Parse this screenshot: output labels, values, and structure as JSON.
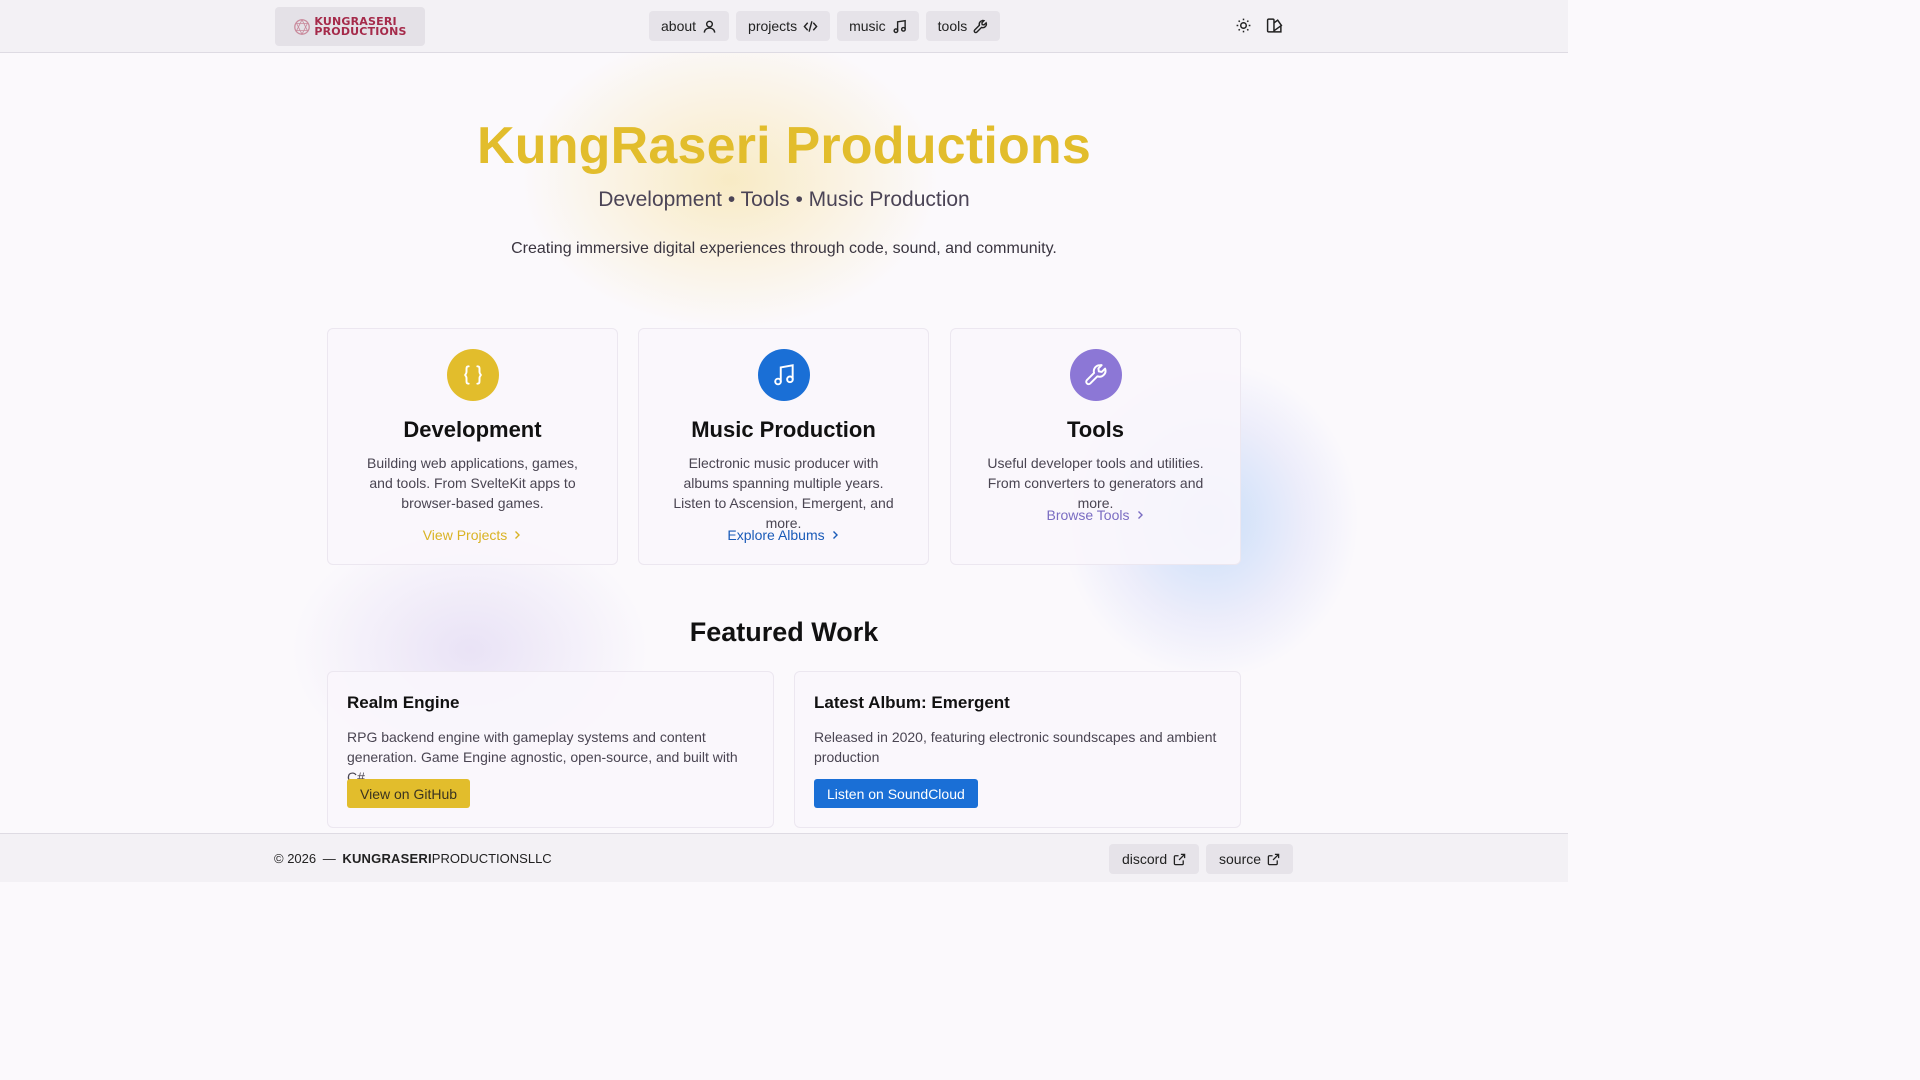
{
  "header": {
    "logo_line1": "KUNGRASERI",
    "logo_line2": "PRODUCTIONS",
    "nav": [
      {
        "label": "about",
        "icon": "user-icon"
      },
      {
        "label": "projects",
        "icon": "code-icon"
      },
      {
        "label": "music",
        "icon": "music-note-icon"
      },
      {
        "label": "tools",
        "icon": "wrench-icon"
      }
    ],
    "theme_toggle_icon": "sun-icon",
    "palette_icon": "palette-icon"
  },
  "hero": {
    "title": "KungRaseri Productions",
    "subtitle": "Development • Tools • Music Production",
    "description": "Creating immersive digital experiences through code, sound, and community."
  },
  "cards": [
    {
      "title": "Development",
      "text": "Building web applications, games, and tools. From SvelteKit apps to browser-based games.",
      "link": "View Projects",
      "icon": "braces-icon",
      "color": "#e2bd2c"
    },
    {
      "title": "Music Production",
      "text": "Electronic music producer with albums spanning multiple years. Listen to Ascension, Emergent, and more.",
      "link": "Explore Albums",
      "icon": "music-note-icon",
      "color": "#1a6fd6"
    },
    {
      "title": "Tools",
      "text": "Useful developer tools and utilities. From converters to generators and more.",
      "link": "Browse Tools",
      "icon": "wrench-icon",
      "color": "#8c77d6"
    }
  ],
  "featured": {
    "title": "Featured Work",
    "items": [
      {
        "title": "Realm Engine",
        "text": "RPG backend engine with gameplay systems and content generation. Game Engine agnostic, open-source, and built with C#.",
        "button": "View on GitHub",
        "color": "#e2bd2c"
      },
      {
        "title": "Latest Album: Emergent",
        "text": "Released in 2020, featuring electronic soundscapes and ambient production",
        "button": "Listen on SoundCloud",
        "color": "#1a6fd6"
      }
    ]
  },
  "footer": {
    "copyright": "© 2026",
    "dash": "—",
    "brand_bold": "KUNGRASERI",
    "brand_rest": "PRODUCTIONSLLC",
    "links": [
      {
        "label": "discord",
        "icon": "external-link-icon"
      },
      {
        "label": "source",
        "icon": "external-link-icon"
      }
    ]
  }
}
